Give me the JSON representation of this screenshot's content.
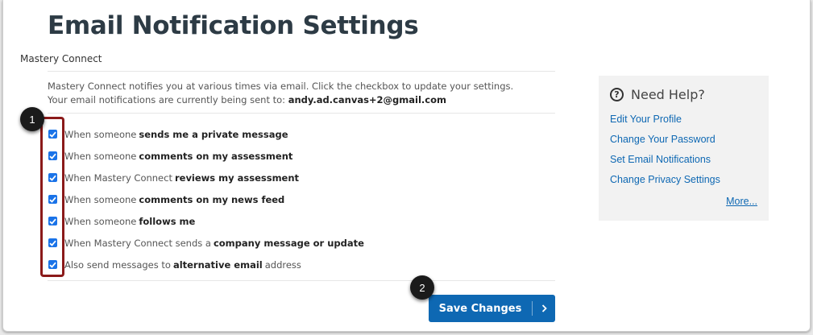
{
  "page": {
    "title": "Email Notification Settings",
    "breadcrumb": "Mastery Connect"
  },
  "intro": {
    "line1": "Mastery Connect notifies you at various times via email. Click the checkbox to update your settings.",
    "line2_prefix": "Your email notifications are currently being sent to:",
    "email": "andy.ad.canvas+2@gmail.com"
  },
  "options": [
    {
      "pre": "When someone",
      "bold": "sends me a private message",
      "post": "",
      "checked": true
    },
    {
      "pre": "When someone",
      "bold": "comments on my assessment",
      "post": "",
      "checked": true
    },
    {
      "pre": "When Mastery Connect",
      "bold": "reviews my assessment",
      "post": "",
      "checked": true
    },
    {
      "pre": "When someone",
      "bold": "comments on my news feed",
      "post": "",
      "checked": true
    },
    {
      "pre": "When someone",
      "bold": "follows me",
      "post": "",
      "checked": true
    },
    {
      "pre": "When Mastery Connect sends a",
      "bold": "company message or update",
      "post": "",
      "checked": true
    },
    {
      "pre": "Also send messages to",
      "bold": "alternative email",
      "post": "address",
      "checked": true
    }
  ],
  "save_button": {
    "label": "Save Changes",
    "icon": "chevron-right-icon"
  },
  "help": {
    "title": "Need Help?",
    "icon": "question-circle-icon",
    "links": [
      "Edit Your Profile",
      "Change Your Password",
      "Set Email Notifications",
      "Change Privacy Settings"
    ],
    "more": "More..."
  },
  "callouts": [
    "1",
    "2"
  ],
  "colors": {
    "accent": "#0e68b3",
    "checkbox": "#1a73e8",
    "highlight": "#8b1a1a",
    "title": "#2d3b45"
  }
}
